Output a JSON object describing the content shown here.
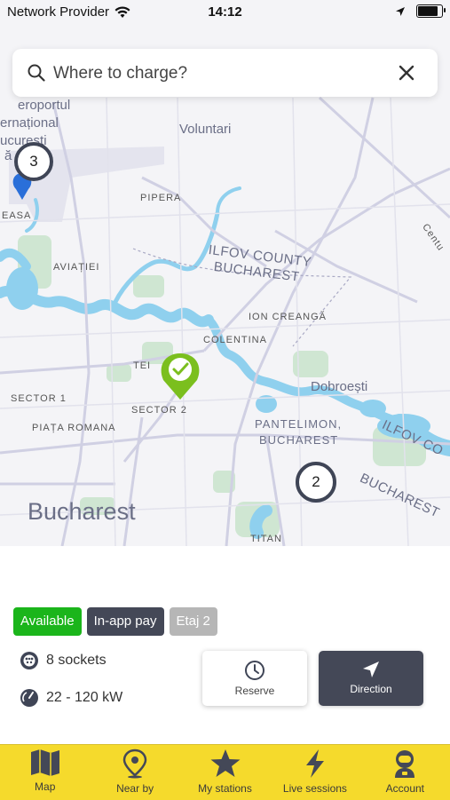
{
  "status": {
    "carrier": "Network Provider",
    "time": "14:12",
    "battery_level": 0.85
  },
  "search": {
    "placeholder": "Where to charge?",
    "value": ""
  },
  "map": {
    "labels": {
      "airport_1": "eroportul",
      "airport_2": "ernațional",
      "airport_3": "ucurești",
      "airport_4": "ă",
      "voluntari": "Voluntari",
      "pipera": "PIPERA",
      "easa": "EASA",
      "aviatiei": "AVIAȚIEI",
      "ilfov_county": "ILFOV COUNTY",
      "bucharest_county": "BUCHAREST",
      "centura": "Centu",
      "ion_creanga": "ION CREANGĂ",
      "colentina": "COLENTINA",
      "tei": "TEI",
      "sector1": "SECTOR 1",
      "sector2": "SECTOR 2",
      "dobroesti": "Dobroești",
      "pantelimon": "PANTELIMON,",
      "pantelimon_b": "BUCHAREST",
      "ilfov_co": "ILFOV CO",
      "piata_romana": "PIAȚA ROMANA",
      "bucharest_east": "BUCHAREST",
      "bucharest_city": "Bucharest",
      "titan": "TITAN"
    },
    "clusters": [
      {
        "count": "3"
      },
      {
        "count": "2"
      }
    ],
    "colors": {
      "water": "#8fd0ee",
      "park": "#cfe6d2",
      "road": "#d3d3e6",
      "pin": "#7bbf1e"
    }
  },
  "station": {
    "tags": [
      {
        "label": "Available",
        "color": "#1bb51b"
      },
      {
        "label": "In-app pay",
        "color": "#444857"
      },
      {
        "label": "Etaj 2",
        "color": "#b6b6b6"
      }
    ],
    "sockets": "8 sockets",
    "power": "22 - 120 kW",
    "reserve_label": "Reserve",
    "direction_label": "Direction"
  },
  "tabbar": {
    "accent": "#f5da2c",
    "items": [
      {
        "label": "Map",
        "icon": "map-icon"
      },
      {
        "label": "Near by",
        "icon": "location-pin-icon"
      },
      {
        "label": "My stations",
        "icon": "star-icon"
      },
      {
        "label": "Live sessions",
        "icon": "lightning-icon"
      },
      {
        "label": "Account",
        "icon": "astronaut-icon"
      }
    ]
  }
}
